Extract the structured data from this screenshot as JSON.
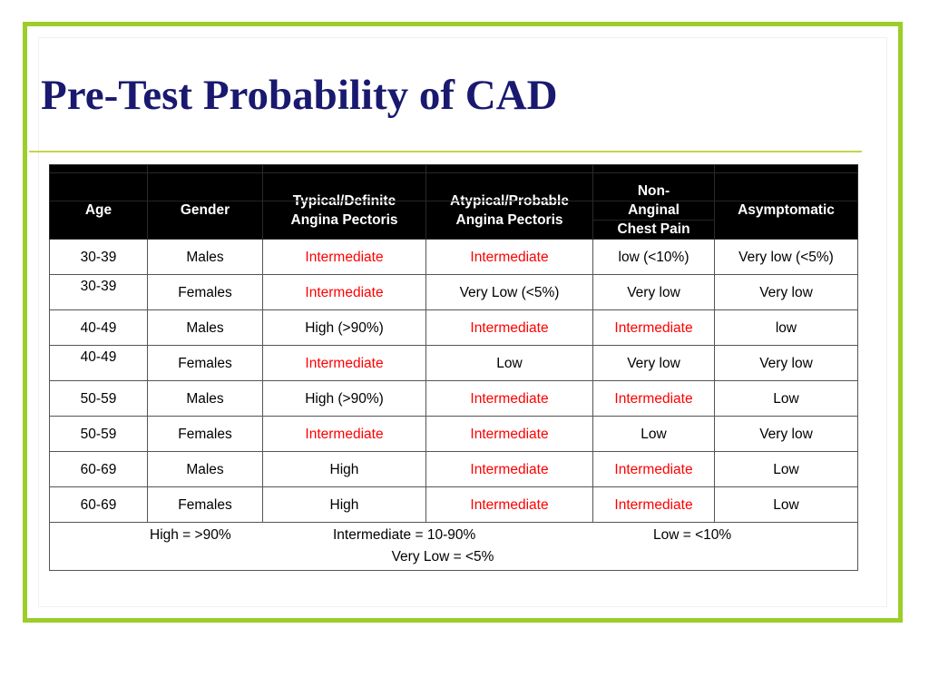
{
  "slide": {
    "title": "Pre-Test Probability of CAD",
    "accent_color": "#9ccd29",
    "title_color": "#191970",
    "rule_color": "#c6d64a",
    "highlight_color": "#fe0000"
  },
  "table": {
    "headers": {
      "age": [
        "Age"
      ],
      "gender": [
        "Gender"
      ],
      "typical": [
        "Typical/Definite",
        "Angina Pectoris"
      ],
      "atypical": [
        "Atypical/Probable",
        "Angina Pectoris"
      ],
      "nonanginal": [
        "Non-",
        "Anginal",
        "Chest Pain"
      ],
      "asymptomatic": [
        "Asymptomatic"
      ]
    },
    "rows": [
      {
        "age": "30-39",
        "gender": "Males",
        "typical": "Intermediate",
        "typical_red": true,
        "atypical": "Intermediate",
        "atypical_red": true,
        "nonanginal": "low (<10%)",
        "nonanginal_red": false,
        "asymptomatic": "Very low (<5%)",
        "asymptomatic_red": false,
        "age_raised": false
      },
      {
        "age": "30-39",
        "gender": "Females",
        "typical": "Intermediate",
        "typical_red": true,
        "atypical": "Very Low (<5%)",
        "atypical_red": false,
        "nonanginal": "Very low",
        "nonanginal_red": false,
        "asymptomatic": "Very low",
        "asymptomatic_red": false,
        "age_raised": true
      },
      {
        "age": "40-49",
        "gender": "Males",
        "typical": "High (>90%)",
        "typical_red": false,
        "atypical": "Intermediate",
        "atypical_red": true,
        "nonanginal": "Intermediate",
        "nonanginal_red": true,
        "asymptomatic": "low",
        "asymptomatic_red": false,
        "age_raised": false
      },
      {
        "age": "40-49",
        "gender": "Females",
        "typical": "Intermediate",
        "typical_red": true,
        "atypical": "Low",
        "atypical_red": false,
        "nonanginal": "Very low",
        "nonanginal_red": false,
        "asymptomatic": "Very low",
        "asymptomatic_red": false,
        "age_raised": true
      },
      {
        "age": "50-59",
        "gender": "Males",
        "typical": "High (>90%)",
        "typical_red": false,
        "atypical": "Intermediate",
        "atypical_red": true,
        "nonanginal": "Intermediate",
        "nonanginal_red": true,
        "asymptomatic": "Low",
        "asymptomatic_red": false,
        "age_raised": false
      },
      {
        "age": "50-59",
        "gender": "Females",
        "typical": "Intermediate",
        "typical_red": true,
        "atypical": "Intermediate",
        "atypical_red": true,
        "nonanginal": "Low",
        "nonanginal_red": false,
        "asymptomatic": "Very low",
        "asymptomatic_red": false,
        "age_raised": false
      },
      {
        "age": "60-69",
        "gender": "Males",
        "typical": "High",
        "typical_red": false,
        "atypical": "Intermediate",
        "atypical_red": true,
        "nonanginal": "Intermediate",
        "nonanginal_red": true,
        "asymptomatic": "Low",
        "asymptomatic_red": false,
        "age_raised": false
      },
      {
        "age": "60-69",
        "gender": "Females",
        "typical": "High",
        "typical_red": false,
        "atypical": "Intermediate",
        "atypical_red": true,
        "nonanginal": "Intermediate",
        "nonanginal_red": true,
        "asymptomatic": "Low",
        "asymptomatic_red": false,
        "age_raised": false
      }
    ],
    "legend": {
      "high": "High = >90%",
      "intermediate": "Intermediate = 10-90%",
      "low": "Low = <10%",
      "very_low": "Very Low = <5%"
    }
  }
}
